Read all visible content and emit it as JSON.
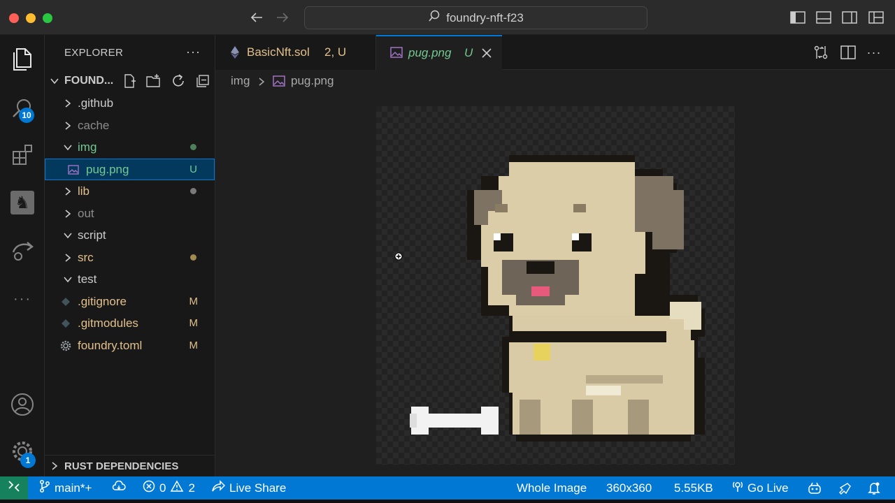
{
  "window": {
    "search_text": "foundry-nft-f23"
  },
  "activity_bar": {
    "search_badge": "10",
    "settings_badge": "1"
  },
  "explorer": {
    "title": "EXPLORER",
    "more": "···",
    "project_name": "FOUND...",
    "items": [
      {
        "label": ".github",
        "kind": "folder",
        "expanded": false,
        "color": "#cccccc"
      },
      {
        "label": "cache",
        "kind": "folder",
        "expanded": false,
        "color": "#8c8c8c"
      },
      {
        "label": "img",
        "kind": "folder",
        "expanded": true,
        "color": "#73c991",
        "dot": "#4f7f5a"
      },
      {
        "label": "pug.png",
        "kind": "image",
        "status": "U",
        "color": "#73c991",
        "selected": true
      },
      {
        "label": "lib",
        "kind": "folder",
        "expanded": false,
        "color": "#e2c08d",
        "dot": "#7a7a7a"
      },
      {
        "label": "out",
        "kind": "folder",
        "expanded": false,
        "color": "#8c8c8c"
      },
      {
        "label": "script",
        "kind": "folder",
        "expanded": true,
        "color": "#cccccc"
      },
      {
        "label": "src",
        "kind": "folder",
        "expanded": false,
        "color": "#e2c08d",
        "dot": "#a08a4f"
      },
      {
        "label": "test",
        "kind": "folder",
        "expanded": true,
        "color": "#cccccc"
      },
      {
        "label": ".gitignore",
        "kind": "git",
        "status": "M",
        "color": "#e2c08d"
      },
      {
        "label": ".gitmodules",
        "kind": "git",
        "status": "M",
        "color": "#e2c08d"
      },
      {
        "label": "foundry.toml",
        "kind": "gear",
        "status": "M",
        "color": "#e2c08d"
      }
    ],
    "rust_dependencies": "RUST DEPENDENCIES"
  },
  "tabs": [
    {
      "label": "BasicNft.sol",
      "status": "2, U",
      "active": false
    },
    {
      "label": "pug.png",
      "status": "U",
      "active": true
    }
  ],
  "breadcrumb": {
    "folder": "img",
    "file": "pug.png"
  },
  "statusbar": {
    "branch": "main*+",
    "errors": "0",
    "warnings": "2",
    "live_share": "Live Share",
    "zoom": "Whole Image",
    "dimensions": "360x360",
    "size": "5.55KB",
    "go_live": "Go Live"
  },
  "colors": {
    "accent": "#0078d4",
    "untracked": "#73c991",
    "modified": "#e2c08d"
  }
}
